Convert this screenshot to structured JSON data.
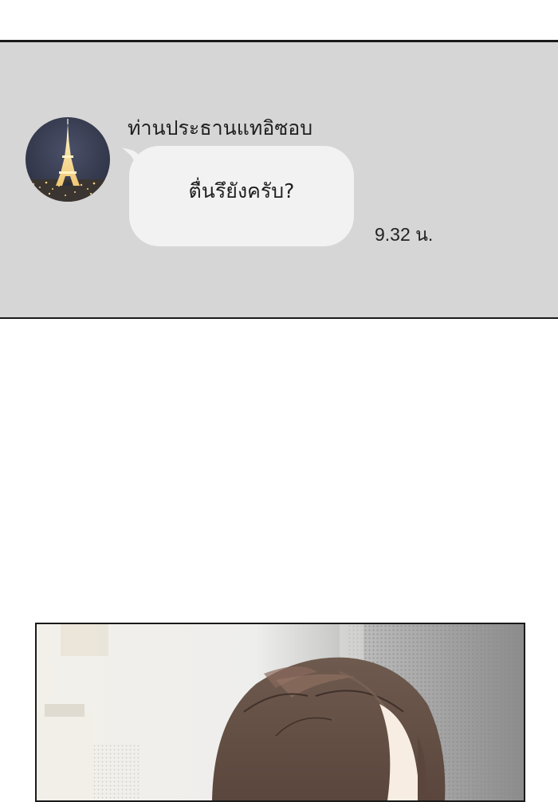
{
  "chat": {
    "sender_name": "ท่านประธานแทอิซอบ",
    "message_text": "ตื่นรึยังครับ?",
    "timestamp": "9.32 น.",
    "avatar_icon": "eiffel-tower-night-avatar",
    "colors": {
      "panel_background": "#d6d6d6",
      "bubble_background": "#f2f2f2",
      "text": "#1f1f1f"
    }
  },
  "comic_panel": {
    "illustration": "woman-brown-hair-top-of-head"
  }
}
